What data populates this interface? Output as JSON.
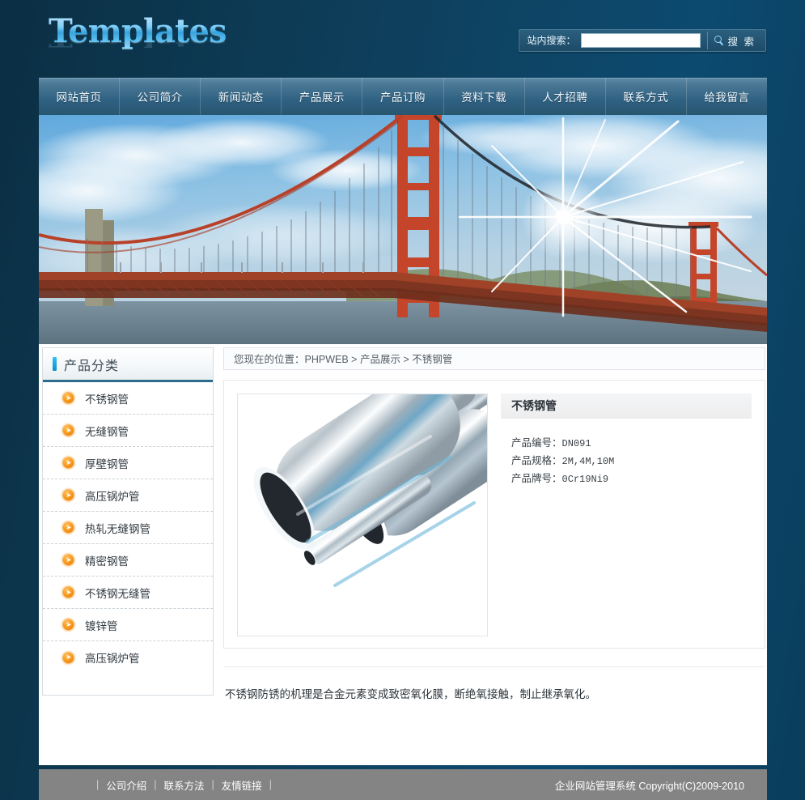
{
  "header": {
    "logo_text": "Templates",
    "search": {
      "label": "站内搜索：",
      "value": "",
      "placeholder": "",
      "button_label": "搜 索",
      "button_icon": "search-icon"
    }
  },
  "nav": {
    "items": [
      {
        "label": "网站首页"
      },
      {
        "label": "公司简介"
      },
      {
        "label": "新闻动态"
      },
      {
        "label": "产品展示"
      },
      {
        "label": "产品订购"
      },
      {
        "label": "资料下载"
      },
      {
        "label": "人才招聘"
      },
      {
        "label": "联系方式"
      },
      {
        "label": "给我留言"
      }
    ]
  },
  "hero": {
    "alt": "golden-gate-bridge-banner"
  },
  "sidebar": {
    "title": "产品分类",
    "items": [
      {
        "label": "不锈钢管",
        "icon": "arrow-bullet-icon"
      },
      {
        "label": "无缝钢管",
        "icon": "arrow-bullet-icon"
      },
      {
        "label": "厚壁钢管",
        "icon": "arrow-bullet-icon"
      },
      {
        "label": "高压锅炉管",
        "icon": "arrow-bullet-icon"
      },
      {
        "label": "热轧无缝钢管",
        "icon": "arrow-bullet-icon"
      },
      {
        "label": "精密钢管",
        "icon": "arrow-bullet-icon"
      },
      {
        "label": "不锈钢无缝管",
        "icon": "arrow-bullet-icon"
      },
      {
        "label": "镀锌管",
        "icon": "arrow-bullet-icon"
      },
      {
        "label": "高压锅炉管",
        "icon": "arrow-bullet-icon"
      }
    ]
  },
  "main": {
    "breadcrumb": {
      "prefix": "您现在的位置：",
      "root": "PHPWEB",
      "sep1": " > ",
      "section": "产品展示",
      "sep2": " > ",
      "current": "不锈钢管"
    },
    "product": {
      "image_alt": "stainless-steel-pipes-photo",
      "title": "不锈钢管",
      "fields": [
        {
          "label": "产品编号：",
          "value": "DN091"
        },
        {
          "label": "产品规格：",
          "value": "2M,4M,10M"
        },
        {
          "label": "产品牌号：",
          "value": "0Cr19Ni9"
        }
      ],
      "description": "不锈钢防锈的机理是合金元素变成致密氧化膜，断绝氧接触，制止继承氧化。"
    }
  },
  "footer": {
    "links": [
      {
        "label": "公司介绍"
      },
      {
        "label": "联系方法"
      },
      {
        "label": "友情链接"
      }
    ],
    "separator": "|",
    "copyright": "企业网站管理系统  Copyright(C)2009-2010"
  },
  "colors": {
    "page_bg": "#0d3a54",
    "nav_bg": "#2f6182",
    "accent_blue": "#0d8fc9",
    "bullet_orange": "#f79d20",
    "footer_bg": "#848484",
    "sidebar_underline": "#2d6c8c"
  }
}
